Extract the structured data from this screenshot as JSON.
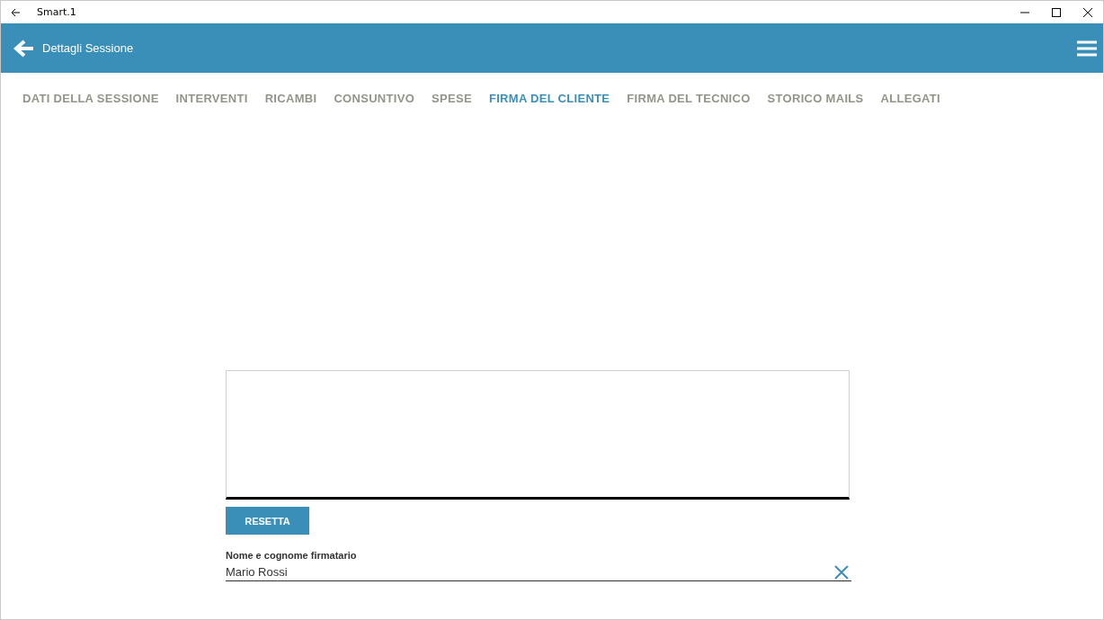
{
  "window": {
    "title": "Smart.1"
  },
  "header": {
    "title": "Dettagli Sessione"
  },
  "tabs": [
    {
      "label": "DATI DELLA SESSIONE",
      "selected": false
    },
    {
      "label": "INTERVENTI",
      "selected": false
    },
    {
      "label": "RICAMBI",
      "selected": false
    },
    {
      "label": "CONSUNTIVO",
      "selected": false
    },
    {
      "label": "SPESE",
      "selected": false
    },
    {
      "label": "FIRMA DEL CLIENTE",
      "selected": true
    },
    {
      "label": "FIRMA DEL TECNICO",
      "selected": false
    },
    {
      "label": "STORICO MAILS",
      "selected": false
    },
    {
      "label": "ALLEGATI",
      "selected": false
    }
  ],
  "signature": {
    "reset_button": "RESETTA",
    "name_label": "Nome e cognome firmatario",
    "name_value": "Mario Rossi"
  }
}
